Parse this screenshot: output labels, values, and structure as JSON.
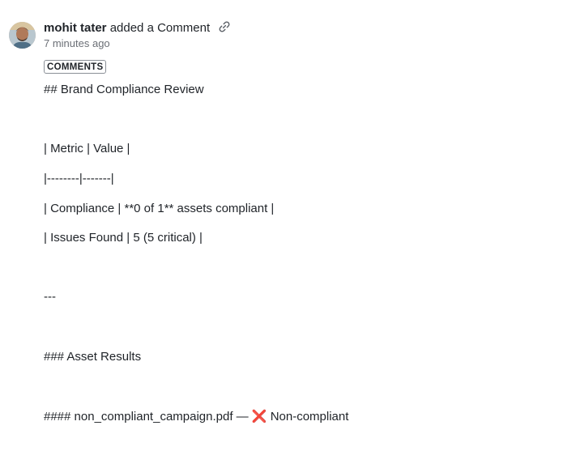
{
  "comment": {
    "author": "mohit tater",
    "action_text": "added a",
    "object_text": "Comment",
    "timestamp": "7 minutes ago",
    "tag": "COMMENTS",
    "link_icon": "link-icon",
    "avatar_icon": "avatar"
  },
  "body": {
    "heading": "## Brand Compliance Review",
    "table_header": "| Metric | Value |",
    "table_separator": "|--------|-------|",
    "row_compliance": "| Compliance | **0 of 1** assets compliant |",
    "row_issues": "| Issues Found | 5 (5 critical) |",
    "rule": "---",
    "subheading": "### Asset Results",
    "asset_prefix": "#### non_compliant_campaign.pdf — ",
    "status_mark": "❌",
    "status_text": " Non-compliant"
  },
  "colors": {
    "text": "#1f2328",
    "muted": "#6b6f76",
    "error": "#e0242a"
  }
}
